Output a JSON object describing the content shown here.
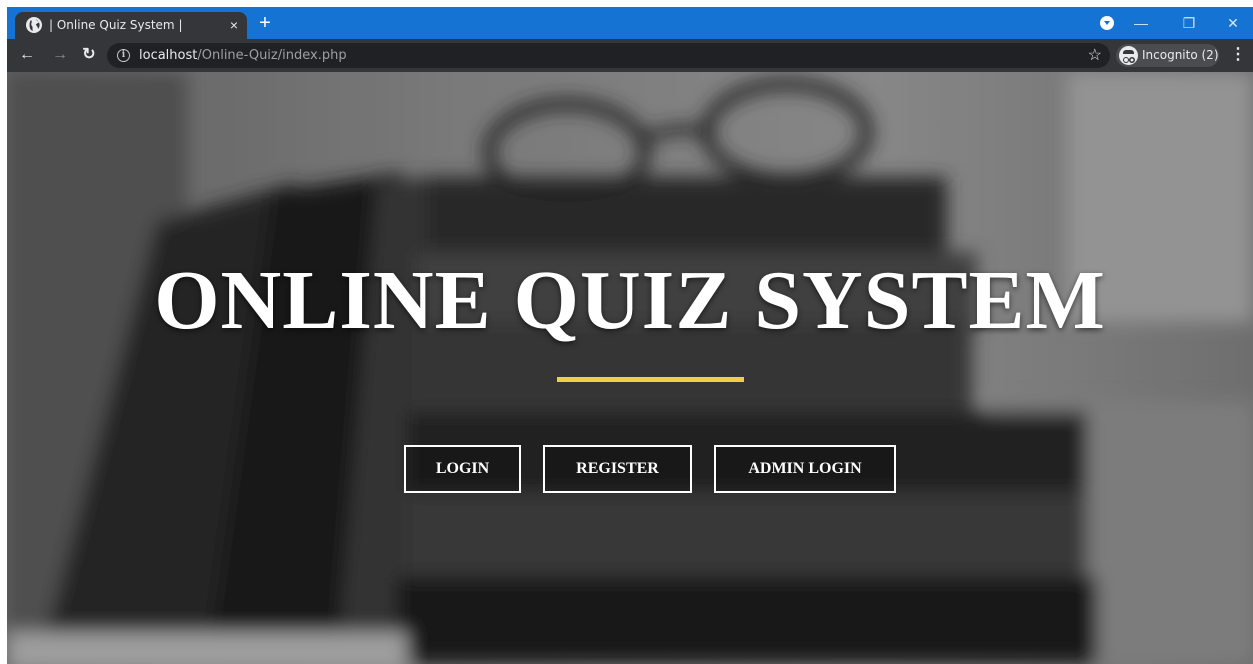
{
  "browser": {
    "tab_title": "| Online Quiz System |",
    "tab_close_glyph": "×",
    "new_tab_glyph": "+",
    "url_host": "localhost",
    "url_path": "/Online-Quiz/index.php",
    "profile_label": "Incognito (2)",
    "icons": {
      "favicon": "globe-icon",
      "back": "arrow-left-icon",
      "forward": "arrow-right-icon",
      "reload": "reload-icon",
      "info": "info-icon",
      "bookmark": "star-icon",
      "incognito": "incognito-icon",
      "menu": "kebab-menu-icon",
      "minimize": "minimize-icon",
      "restore": "restore-icon",
      "close": "close-icon"
    },
    "colors": {
      "titlebar": "#1473d3",
      "toolbar": "#35363a",
      "omnibox": "#202124"
    }
  },
  "hero": {
    "title": "ONLINE QUIZ SYSTEM",
    "accent_color": "#f2cd45"
  },
  "buttons": {
    "login": "LOGIN",
    "register": "REGISTER",
    "admin_login": "ADMIN LOGIN"
  }
}
